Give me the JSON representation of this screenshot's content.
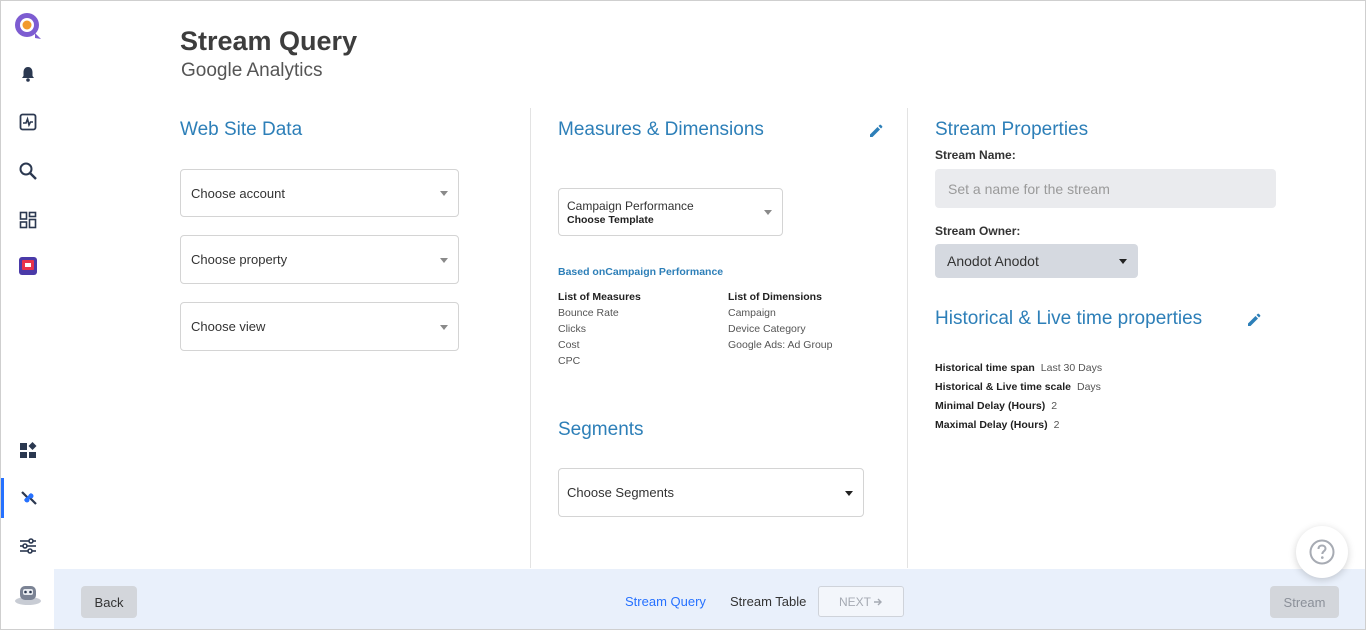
{
  "sidebar": {
    "items": [
      {
        "name": "anodot-logo-icon",
        "active": false
      },
      {
        "name": "bell-icon",
        "active": false
      },
      {
        "name": "activity-chart-icon",
        "active": false
      },
      {
        "name": "search-icon",
        "active": false
      },
      {
        "name": "dashboard-grid-icon",
        "active": false
      },
      {
        "name": "tv-app-icon",
        "active": false
      },
      {
        "name": "widgets-icon",
        "active": false
      },
      {
        "name": "integrations-icon",
        "active": true
      },
      {
        "name": "settings-sliders-icon",
        "active": false
      },
      {
        "name": "user-avatar-icon",
        "active": false
      }
    ]
  },
  "header": {
    "title": "Stream Query",
    "subtitle": "Google Analytics"
  },
  "website_data": {
    "title": "Web Site Data",
    "account_placeholder": "Choose account",
    "property_placeholder": "Choose property",
    "view_placeholder": "Choose view"
  },
  "measures": {
    "title": "Measures & Dimensions",
    "template_value": "Campaign Performance",
    "template_label": "Choose Template",
    "based_on": "Based onCampaign Performance",
    "measures_header": "List of Measures",
    "measures_list": [
      "Bounce Rate",
      "Clicks",
      "Cost",
      "CPC"
    ],
    "dimensions_header": "List of Dimensions",
    "dimensions_list": [
      "Campaign",
      "Device Category",
      "Google Ads: Ad Group"
    ]
  },
  "segments": {
    "title": "Segments",
    "placeholder": "Choose Segments"
  },
  "stream_properties": {
    "title": "Stream Properties",
    "name_label": "Stream Name:",
    "name_placeholder": "Set a name for the stream",
    "owner_label": "Stream Owner:",
    "owner_value": "Anodot Anodot"
  },
  "time_properties": {
    "title": "Historical & Live time properties",
    "rows": [
      {
        "label": "Historical time span",
        "value": "Last 30 Days"
      },
      {
        "label": "Historical & Live time scale",
        "value": "Days"
      },
      {
        "label": "Minimal Delay (Hours)",
        "value": "2"
      },
      {
        "label": "Maximal Delay (Hours)",
        "value": "2"
      }
    ]
  },
  "footer": {
    "back_label": "Back",
    "step_query": "Stream Query",
    "step_table": "Stream Table",
    "next_label": "NEXT",
    "stream_label": "Stream"
  },
  "colors": {
    "accent": "#2d7fb8",
    "link": "#2671ff",
    "footer_bg": "#e9f0fb"
  }
}
